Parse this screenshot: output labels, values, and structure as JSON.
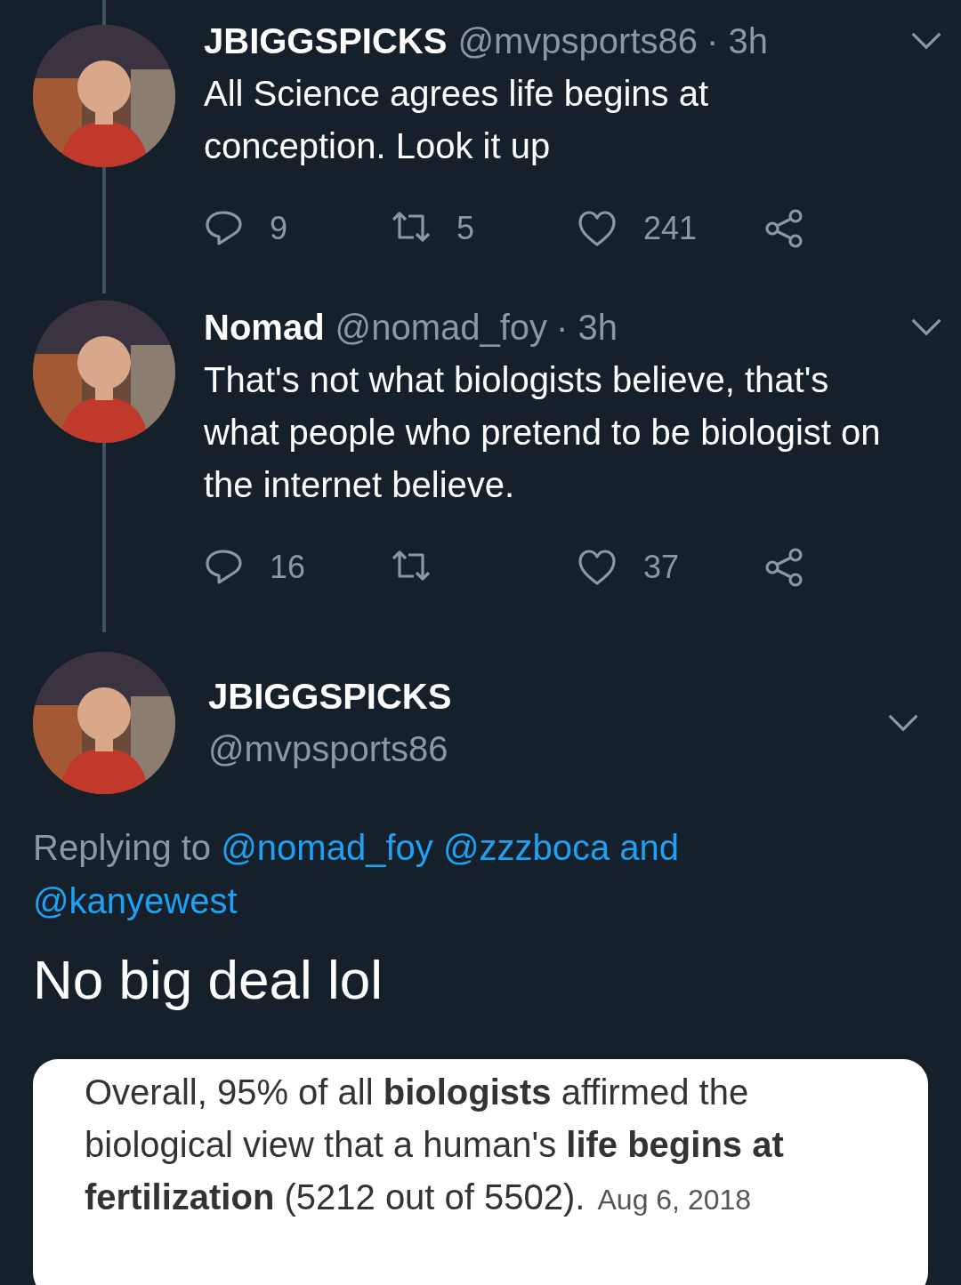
{
  "thread": [
    {
      "name": "JBIGGSPICKS",
      "handle": "@mvpsports86",
      "time": "· 3h",
      "text": "All Science agrees life begins at conception. Look it up",
      "replies": "9",
      "retweets": "5",
      "likes": "241"
    },
    {
      "name": "Nomad",
      "handle": "@nomad_foy",
      "time": "· 3h",
      "text": "That's not what biologists believe, that's what people who pretend to be biologist on the internet believe.",
      "replies": "16",
      "likes": "37"
    }
  ],
  "focused": {
    "name": "JBIGGSPICKS",
    "handle": "@mvpsports86",
    "replying_label": "Replying to",
    "replying_links": [
      "@nomad_foy",
      "@zzzboca and",
      "@kanyewest"
    ],
    "text": "No big deal lol",
    "card": {
      "quote": "Overall, 95% of all **biologists** affirmed the biological view that a human's **life begins at fertilization** (5212 out of 5502).",
      "date": "Aug 6, 2018"
    }
  }
}
